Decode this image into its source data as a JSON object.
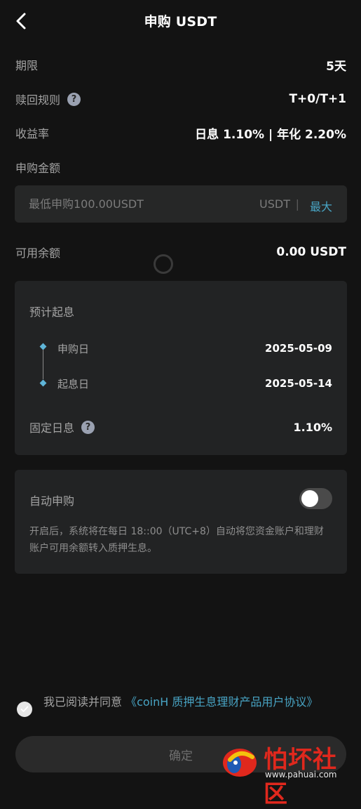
{
  "header": {
    "title": "申购 USDT",
    "back_icon": "chevron-left-icon"
  },
  "info": {
    "term_label": "期限",
    "term_value": "5天",
    "redeem_label": "赎回规则",
    "redeem_value": "T+0/T+1",
    "yield_label": "收益率",
    "yield_value": "日息 1.10% | 年化 2.20%"
  },
  "amount": {
    "label": "申购金额",
    "placeholder": "最低申购100.00USDT",
    "unit": "USDT",
    "separator": "|",
    "max_label": "最大"
  },
  "balance": {
    "label": "可用余额",
    "value": "0.00 USDT"
  },
  "interest_card": {
    "title": "预计起息",
    "start_label": "申购日",
    "start_date": "2025-05-09",
    "accrue_label": "起息日",
    "accrue_date": "2025-05-14",
    "fixed_label": "固定日息",
    "fixed_value": "1.10%"
  },
  "auto_card": {
    "title": "自动申购",
    "toggle_on": false,
    "description": "开启后，系统将在每日 18::00（UTC+8）自动将您资金账户和理财账户可用余额转入质押生息。"
  },
  "agreement": {
    "prefix": "我已阅读并同意 ",
    "link": "《coinH 质押生息理财产品用户协议》",
    "checked": false
  },
  "confirm_label": "确定",
  "watermark": {
    "text": "怕坏社区",
    "url": "www.pahuai.com"
  },
  "colors": {
    "accent": "#48a4c4",
    "background": "#131313",
    "card": "#222324"
  }
}
